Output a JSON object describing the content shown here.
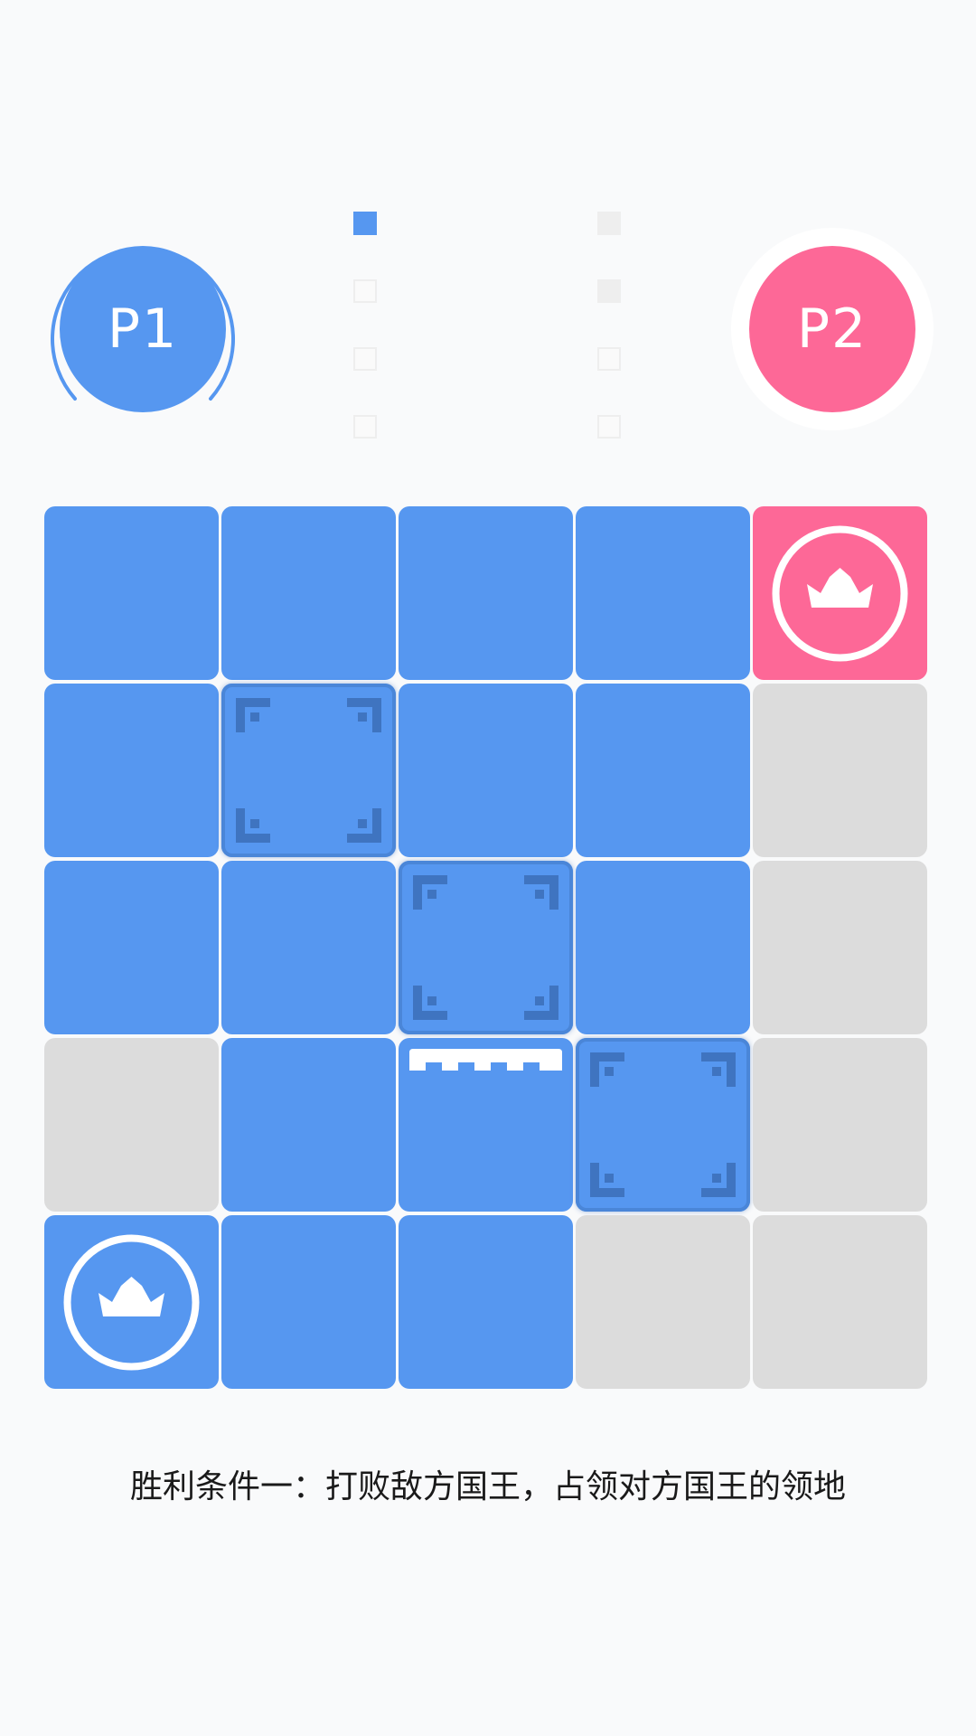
{
  "players": {
    "p1": {
      "label": "P1",
      "color": "#5697f0"
    },
    "p2": {
      "label": "P2",
      "color": "#fd6897"
    }
  },
  "rounds": {
    "p1": [
      true,
      false,
      false,
      false
    ],
    "p2": [
      true,
      true,
      false,
      false
    ]
  },
  "board": {
    "size": 5,
    "cells": [
      [
        "blue",
        "blue",
        "blue",
        "blue",
        "pink"
      ],
      [
        "blue",
        "blue",
        "blue",
        "blue",
        "grey"
      ],
      [
        "blue",
        "blue",
        "blue",
        "blue",
        "grey"
      ],
      [
        "grey",
        "blue",
        "blue",
        "blue",
        "grey"
      ],
      [
        "blue",
        "blue",
        "blue",
        "grey",
        "grey"
      ]
    ],
    "kings": [
      {
        "row": 0,
        "col": 4,
        "owner": "p2",
        "icon": "crown-icon"
      },
      {
        "row": 4,
        "col": 0,
        "owner": "p1",
        "icon": "crown-icon"
      }
    ],
    "highlighted": [
      {
        "row": 1,
        "col": 1,
        "icon": "corner-brackets-icon"
      },
      {
        "row": 2,
        "col": 2,
        "icon": "corner-brackets-icon"
      },
      {
        "row": 3,
        "col": 3,
        "icon": "corner-brackets-icon"
      }
    ],
    "walls": [
      {
        "row": 3,
        "col": 2,
        "icon": "rampart-icon"
      }
    ]
  },
  "colors": {
    "blue": "#5697f0",
    "pink": "#fd6897",
    "grey": "#dcdcdc",
    "highlight_mark": "#3f74c0"
  },
  "caption": "胜利条件一：打败敌方国王，占领对方国王的领地"
}
